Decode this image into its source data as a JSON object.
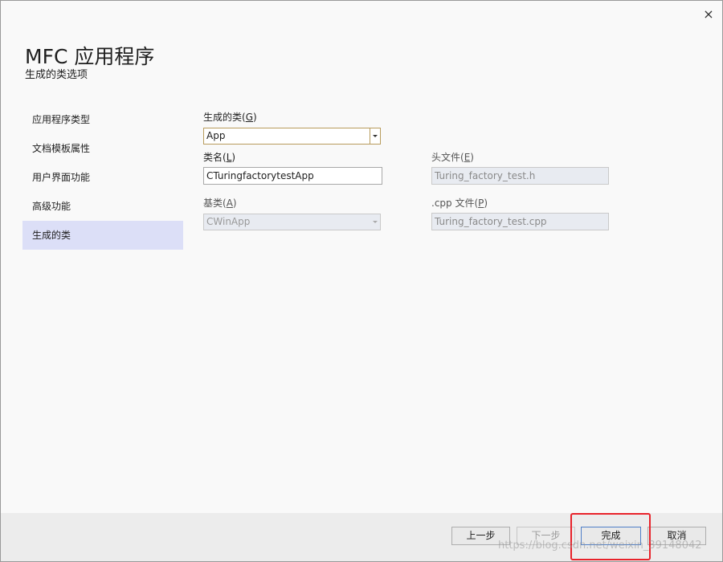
{
  "window": {
    "close_icon": "×"
  },
  "header": {
    "title": "MFC 应用程序",
    "subtitle": "生成的类选项"
  },
  "sidebar": {
    "items": [
      {
        "label": "应用程序类型",
        "selected": false
      },
      {
        "label": "文档模板属性",
        "selected": false
      },
      {
        "label": "用户界面功能",
        "selected": false
      },
      {
        "label": "高级功能",
        "selected": false
      },
      {
        "label": "生成的类",
        "selected": true
      }
    ]
  },
  "form": {
    "generated_class": {
      "label_prefix": "生成的类(",
      "label_key": "G",
      "label_suffix": ")",
      "value": "App"
    },
    "class_name": {
      "label_prefix": "类名(",
      "label_key": "L",
      "label_suffix": ")",
      "value": "CTuringfactorytestApp"
    },
    "header_file": {
      "label_prefix": "头文件(",
      "label_key": "E",
      "label_suffix": ")",
      "value": "Turing_factory_test.h"
    },
    "base_class": {
      "label_prefix": "基类(",
      "label_key": "A",
      "label_suffix": ")",
      "value": "CWinApp"
    },
    "cpp_file": {
      "label_prefix": ".cpp 文件(",
      "label_key": "P",
      "label_suffix": ")",
      "value": "Turing_factory_test.cpp"
    }
  },
  "footer": {
    "back_label": "上一步",
    "next_label": "下一步",
    "finish_label": "完成",
    "cancel_label": "取消"
  },
  "watermark": "https://blog.csdn.net/weixin_39148042",
  "colors": {
    "selected_item_bg": "#dcdff7",
    "highlight_box": "#e8232b",
    "footer_bg": "#ececec"
  }
}
